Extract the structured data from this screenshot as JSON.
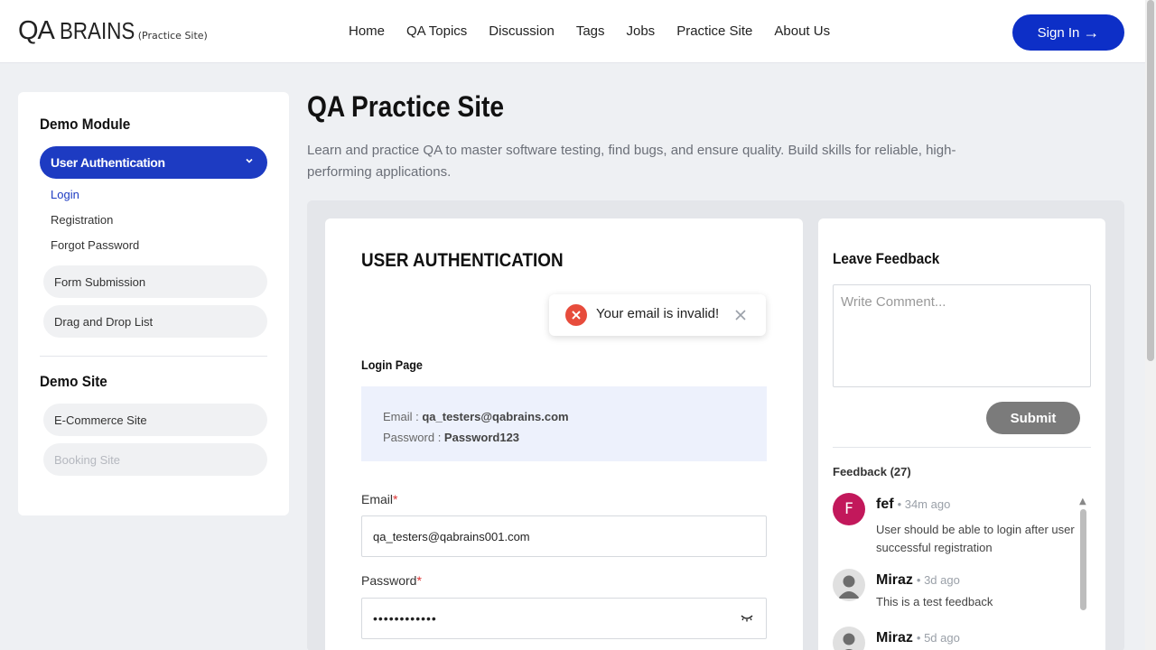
{
  "header": {
    "logo_mark": "QA",
    "logo_word": "BRAINS",
    "logo_sub": "(Practice Site)",
    "nav": [
      "Home",
      "QA Topics",
      "Discussion",
      "Tags",
      "Jobs",
      "Practice Site",
      "About Us"
    ],
    "signin_label": "Sign In",
    "signin_arrow": "→"
  },
  "sidebar": {
    "demo_module_heading": "Demo Module",
    "active_item": "User Authentication",
    "sub_items": [
      "Login",
      "Registration",
      "Forgot Password"
    ],
    "module_items": [
      "Form Submission",
      "Drag and Drop List"
    ],
    "demo_site_heading": "Demo Site",
    "site_items": [
      "E-Commerce Site",
      "Booking Site"
    ]
  },
  "main": {
    "title": "QA Practice Site",
    "description": "Learn and practice QA to master software testing, find bugs, and ensure quality. Build skills for reliable, high-performing applications."
  },
  "auth": {
    "title": "USER AUTHENTICATION",
    "toast_message": "Your email is invalid!",
    "login_heading": "Login Page",
    "cred_email_label": "Email : ",
    "cred_email_value": "qa_testers@qabrains.com",
    "cred_password_label": "Password : ",
    "cred_password_value": "Password123",
    "email_label": "Email",
    "email_value": "qa_testers@qabrains001.com",
    "password_label": "Password",
    "password_value": "••••••••••••",
    "required_mark": "*"
  },
  "feedback": {
    "title": "Leave Feedback",
    "placeholder": "Write Comment...",
    "submit_label": "Submit",
    "count_label": "Feedback (27)",
    "items": [
      {
        "initial": "F",
        "name": "fef",
        "time": "• 34m ago",
        "body": "User should be able to login after user successful registration"
      },
      {
        "initial": "",
        "name": "Miraz",
        "time": "• 3d ago",
        "body": "This is a test feedback"
      },
      {
        "initial": "",
        "name": "Miraz",
        "time": "• 5d ago",
        "body": ""
      }
    ]
  },
  "colors": {
    "primary": "#1d3bc2",
    "signin": "#0d2fc7",
    "error": "#e74c3c",
    "avatar_f": "#c2185b"
  }
}
